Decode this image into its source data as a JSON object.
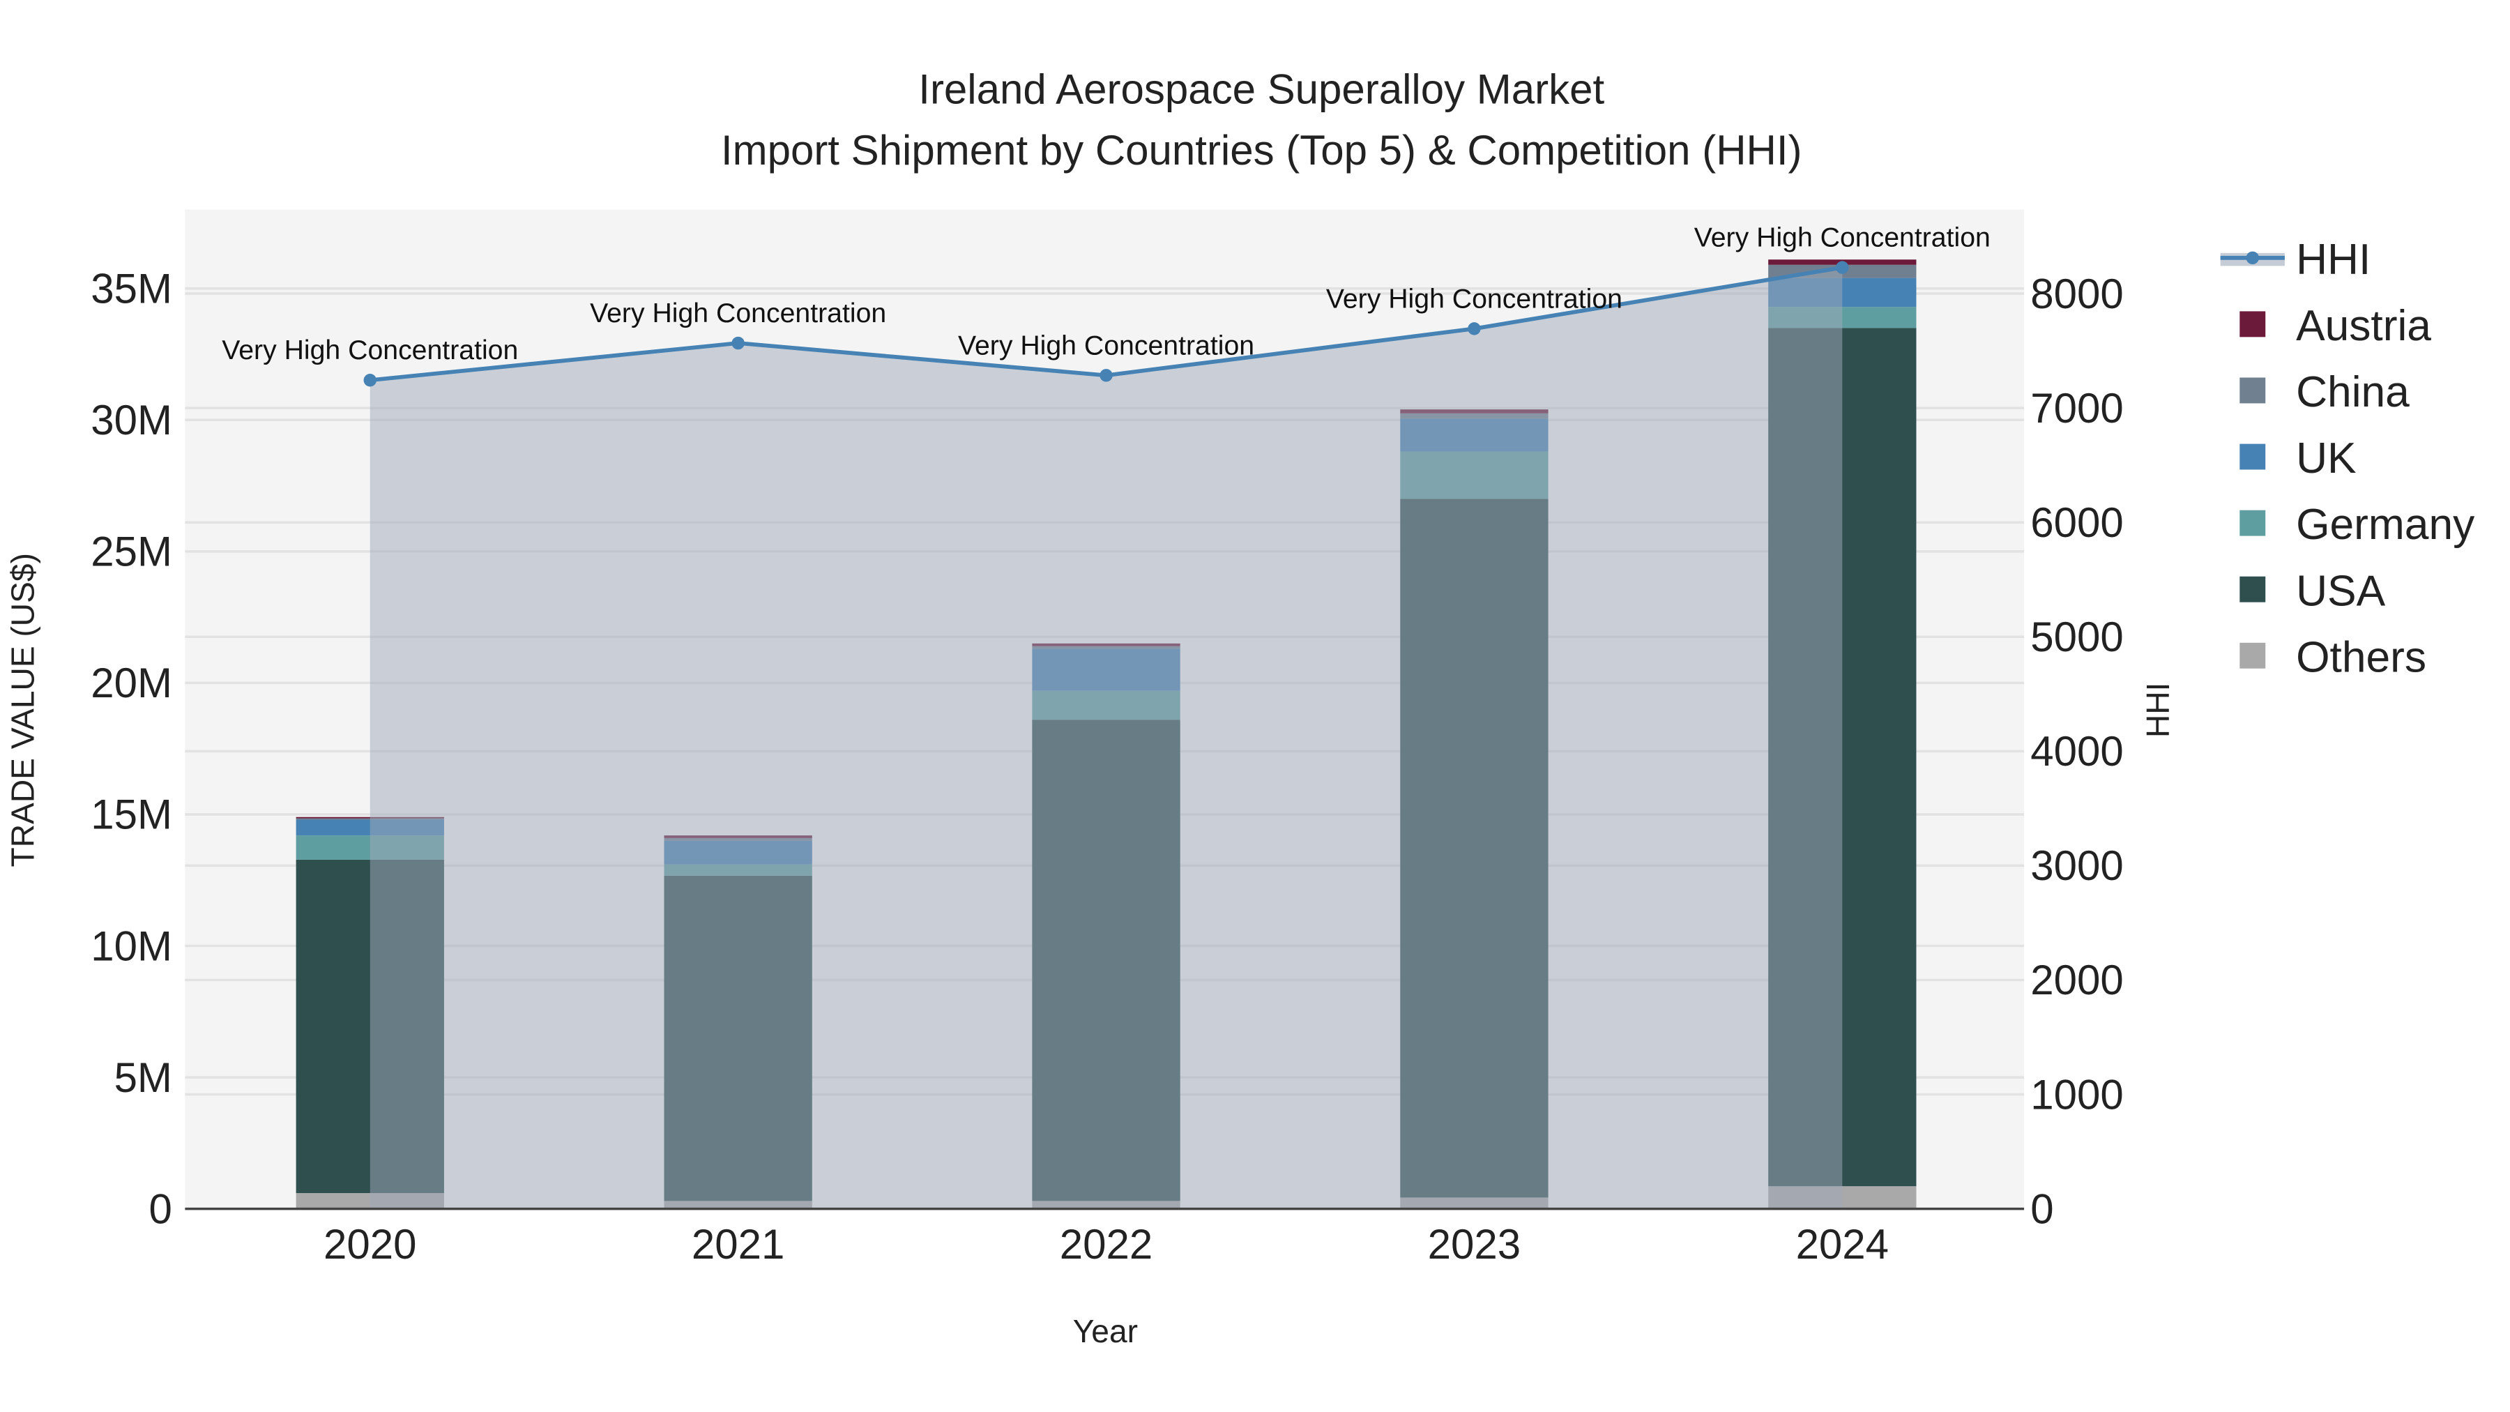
{
  "chart_data": {
    "type": "bar",
    "title": "Ireland Aerospace Superalloy Market",
    "subtitle": "Import Shipment by Countries (Top 5) & Competition (HHI)",
    "xlabel": "Year",
    "ylabel": "TRADE VALUE (US$)",
    "y2label": "HHI",
    "categories": [
      "2020",
      "2021",
      "2022",
      "2023",
      "2024"
    ],
    "ylim": [
      0,
      38000000
    ],
    "y2lim": [
      0,
      8734
    ],
    "yticks": [
      0,
      5000000,
      10000000,
      15000000,
      20000000,
      25000000,
      30000000,
      35000000
    ],
    "ytick_labels": [
      "0",
      "5M",
      "10M",
      "15M",
      "20M",
      "25M",
      "30M",
      "35M"
    ],
    "y2ticks": [
      0,
      1000,
      2000,
      3000,
      4000,
      5000,
      6000,
      7000,
      8000
    ],
    "y2tick_labels": [
      "0",
      "1000",
      "2000",
      "3000",
      "4000",
      "5000",
      "6000",
      "7000",
      "8000"
    ],
    "stacked": true,
    "series": [
      {
        "name": "Others",
        "color": "#a9a9a9",
        "values": [
          600000,
          300000,
          300000,
          430000,
          860000
        ]
      },
      {
        "name": "USA",
        "color": "#2f4f4f",
        "values": [
          12680000,
          12370000,
          18300000,
          26570000,
          32640000
        ]
      },
      {
        "name": "Germany",
        "color": "#5f9ea0",
        "values": [
          920000,
          430000,
          1100000,
          1800000,
          800000
        ]
      },
      {
        "name": "UK",
        "color": "#4682b4",
        "values": [
          600000,
          900000,
          1600000,
          1250000,
          1100000
        ]
      },
      {
        "name": "China",
        "color": "#708090",
        "values": [
          50000,
          100000,
          100000,
          200000,
          500000
        ]
      },
      {
        "name": "Austria",
        "color": "#6b1a3a",
        "values": [
          50000,
          100000,
          100000,
          150000,
          200000
        ]
      }
    ],
    "line": {
      "name": "HHI",
      "color": "#4682b4",
      "axis": "right",
      "values": [
        7243,
        7567,
        7285,
        7693,
        8228
      ],
      "labels": [
        "Very High Concentration",
        "Very High Concentration",
        "Very High Concentration",
        "Very High Concentration",
        "Very High Concentration"
      ]
    },
    "legend": {
      "placement": "right",
      "items": [
        "HHI",
        "Austria",
        "China",
        "UK",
        "Germany",
        "USA",
        "Others"
      ]
    },
    "grid": true
  }
}
